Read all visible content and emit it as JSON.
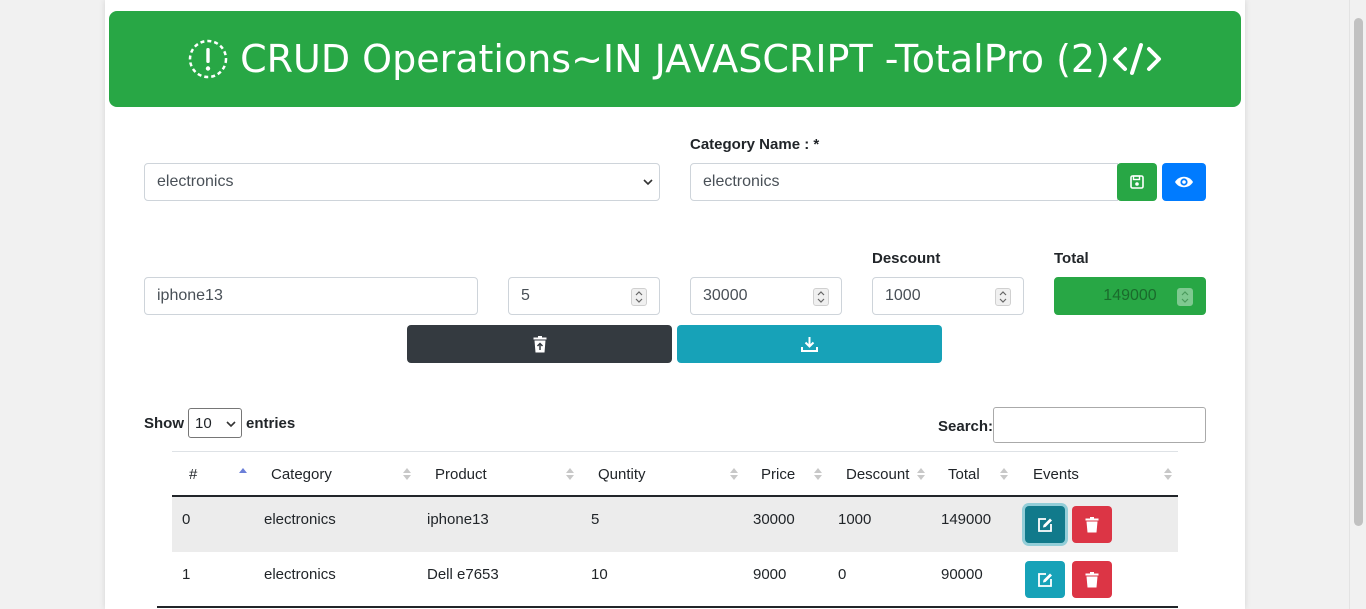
{
  "header": {
    "title": "CRUD Operations~IN JAVASCRIPT -TotalPro (2)",
    "bg_color": "#28a745",
    "left_icon": "info-circle-icon",
    "right_icon": "code-icon"
  },
  "category_form": {
    "select_value": "electronics",
    "name_label": "Category Name : *",
    "name_value": "electronics",
    "save_icon": "save-icon",
    "view_icon": "eye-icon"
  },
  "product_form": {
    "product_value": "iphone13",
    "quantity_value": "5",
    "price_value": "30000",
    "discount_label": "Descount",
    "discount_value": "1000",
    "total_label": "Total",
    "total_value": "149000",
    "clear_icon": "trash-restore-icon",
    "submit_icon": "download-icon"
  },
  "datatable": {
    "show_label": "Show",
    "entries_value": "10",
    "entries_label": "entries",
    "search_label": "Search:",
    "search_value": "",
    "columns": [
      "#",
      "Category",
      "Product",
      "Quntity",
      "Price",
      "Descount",
      "Total",
      "Events"
    ],
    "rows": [
      {
        "id": "0",
        "category": "electronics",
        "product": "iphone13",
        "quantity": "5",
        "price": "30000",
        "discount": "1000",
        "total": "149000"
      },
      {
        "id": "1",
        "category": "electronics",
        "product": "Dell e7653",
        "quantity": "10",
        "price": "9000",
        "discount": "0",
        "total": "90000"
      }
    ],
    "edit_icon": "edit-icon",
    "delete_icon": "trash-icon"
  },
  "colors": {
    "success": "#28a745",
    "primary": "#007bff",
    "dark": "#343a40",
    "info": "#17a2b8",
    "danger": "#dc3545"
  }
}
